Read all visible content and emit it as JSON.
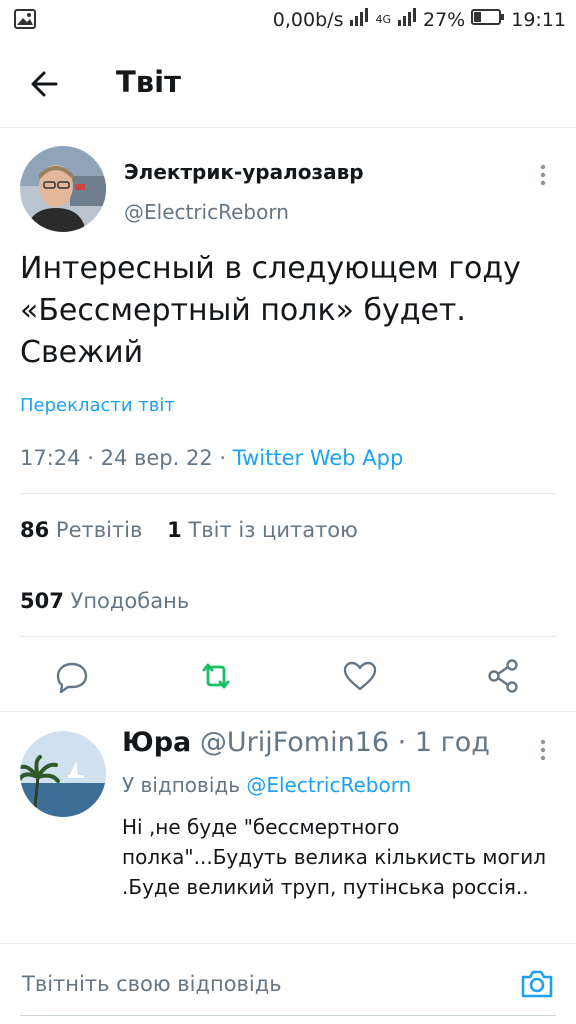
{
  "status_bar": {
    "network_speed": "0,00b/s",
    "net_label": "4G",
    "battery": "27%",
    "time": "19:11"
  },
  "header": {
    "title": "Твіт"
  },
  "tweet": {
    "author_name": "Электрик-уралозавр",
    "author_handle": "@ElectricReborn",
    "text": "Интересный в следующем году\n«Бессмертный полк» будет.\nСвежий",
    "translate_label": "Перекласти твіт",
    "time": "17:24",
    "date": "24 вер. 22",
    "meta_sep": "·",
    "app": "Twitter Web App",
    "retweets_count": "86",
    "retweets_label": "Ретвітів",
    "quotes_count": "1",
    "quotes_label": "Твіт із цитатою",
    "likes_count": "507",
    "likes_label": "Уподобань"
  },
  "reply": {
    "name": "Юра",
    "handle": "@UrijFomin16",
    "time": "· 1 год",
    "reply_to_label": "У відповідь",
    "reply_to_handle": "@ElectricReborn",
    "text": "Ні ,не буде \"бессмертного полка\"...Будуть велика кількисть могил .Буде великий труп, путінська россія.."
  },
  "compose": {
    "placeholder": "Твітніть свою відповідь"
  },
  "icons": {
    "back": "arrow-left-icon",
    "more": "more-vertical-icon",
    "reply": "comment-icon",
    "retweet": "retweet-icon",
    "like": "heart-icon",
    "share": "share-icon",
    "camera": "camera-icon"
  },
  "colors": {
    "accent": "#1da1f2",
    "retweet": "#17bf63",
    "secondary_text": "#657786",
    "primary_text": "#14171a",
    "divider": "#e6ecf0"
  }
}
